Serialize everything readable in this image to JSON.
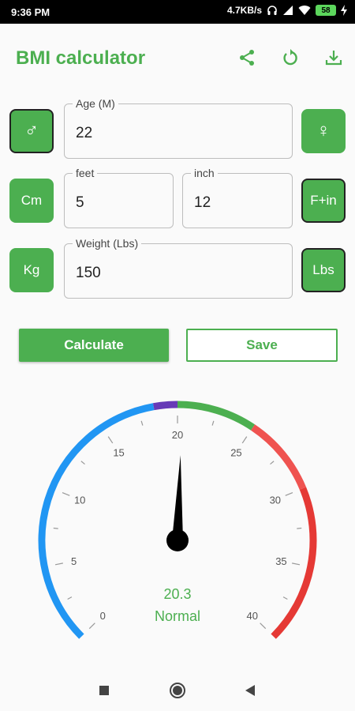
{
  "status": {
    "time": "9:36 PM",
    "speed": "4.7KB/s",
    "battery": "58"
  },
  "app": {
    "title": "BMI calculator"
  },
  "actions": {
    "share": "share-icon",
    "reset": "refresh-icon",
    "download": "download-icon"
  },
  "gender": {
    "male_symbol": "♂",
    "female_symbol": "♀",
    "selected": "male"
  },
  "age": {
    "label": "Age (M)",
    "value": "22"
  },
  "height": {
    "unit_cm": "Cm",
    "unit_ftin": "F+in",
    "selected_unit": "F+in",
    "feet_label": "feet",
    "feet_value": "5",
    "inch_label": "inch",
    "inch_value": "12"
  },
  "weight": {
    "unit_kg": "Kg",
    "unit_lbs": "Lbs",
    "selected_unit": "Lbs",
    "label": "Weight (Lbs)",
    "value": "150"
  },
  "buttons": {
    "calculate": "Calculate",
    "save": "Save"
  },
  "gauge": {
    "min": 0,
    "max": 40,
    "pointer": 20.3,
    "ticks": [
      "0",
      "5",
      "10",
      "15",
      "20",
      "25",
      "30",
      "35",
      "40"
    ],
    "ranges": [
      {
        "from": 0,
        "to": 18.5,
        "color": "#2196f3"
      },
      {
        "from": 18.5,
        "to": 20,
        "color": "#673ab7"
      },
      {
        "from": 20,
        "to": 25,
        "color": "#4caf50"
      },
      {
        "from": 25,
        "to": 30,
        "color": "#ef5350"
      },
      {
        "from": 30,
        "to": 40,
        "color": "#e53935"
      }
    ],
    "value_text": "20.3",
    "category": "Normal"
  },
  "colors": {
    "accent": "#4caf50",
    "selected_border": "#222222"
  }
}
